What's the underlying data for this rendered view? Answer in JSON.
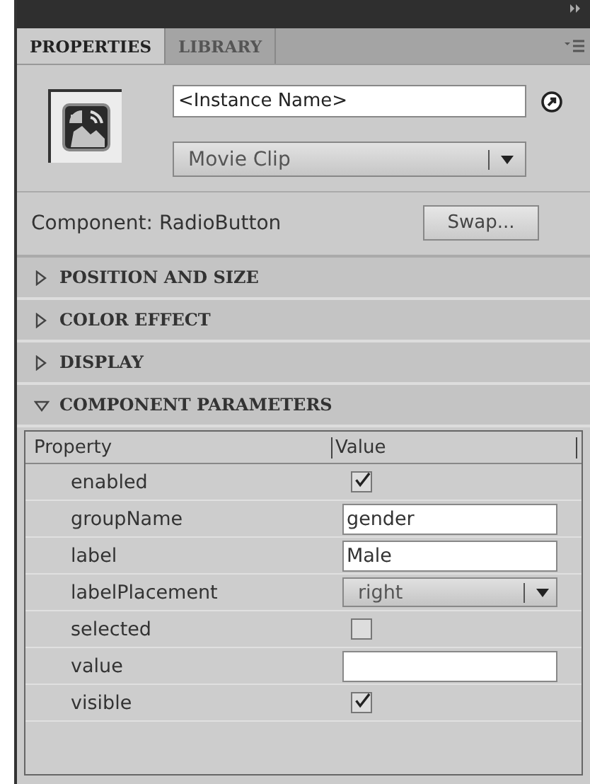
{
  "tabs": [
    {
      "label": "PROPERTIES",
      "selected": true
    },
    {
      "label": "LIBRARY",
      "selected": false
    }
  ],
  "instance": {
    "placeholder": "<Instance Name>"
  },
  "symbol_type": {
    "value": "Movie Clip"
  },
  "component": {
    "label": "Component: RadioButton",
    "button": "Swap..."
  },
  "sections": [
    {
      "title": "POSITION AND SIZE",
      "expanded": false
    },
    {
      "title": "COLOR EFFECT",
      "expanded": false
    },
    {
      "title": "DISPLAY",
      "expanded": false
    },
    {
      "title": "COMPONENT PARAMETERS",
      "expanded": true
    }
  ],
  "table": {
    "columns": [
      "Property",
      "Value"
    ],
    "rows": [
      {
        "property": "enabled",
        "kind": "checkbox",
        "checked": true
      },
      {
        "property": "groupName",
        "kind": "text",
        "value": "gender"
      },
      {
        "property": "label",
        "kind": "text",
        "value": "Male"
      },
      {
        "property": "labelPlacement",
        "kind": "dropdown",
        "value": "right"
      },
      {
        "property": "selected",
        "kind": "checkbox",
        "checked": false
      },
      {
        "property": "value",
        "kind": "text"
      },
      {
        "property": "visible",
        "kind": "checkbox",
        "checked": true
      }
    ]
  }
}
